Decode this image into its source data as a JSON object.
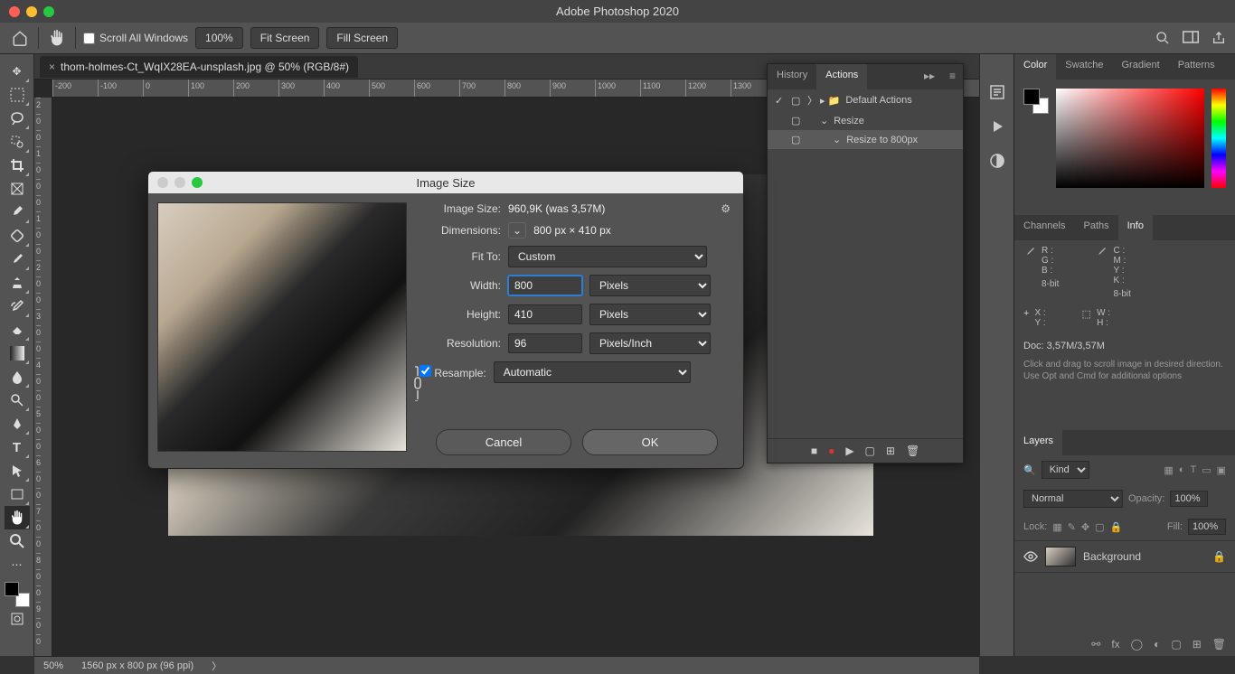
{
  "app": {
    "title": "Adobe Photoshop 2020"
  },
  "options": {
    "scroll_all": "Scroll All Windows",
    "zoom": "100%",
    "fit_screen": "Fit Screen",
    "fill_screen": "Fill Screen"
  },
  "document": {
    "tab": "thom-holmes-Ct_WqIX28EA-unsplash.jpg @ 50% (RGB/8#)",
    "status_zoom": "50%",
    "status_dims": "1560 px x 800 px (96 ppi)"
  },
  "ruler_h": [
    "-200",
    "-100",
    "0",
    "100",
    "200",
    "300",
    "400",
    "500",
    "600",
    "700",
    "800",
    "900",
    "1000",
    "1100",
    "1200",
    "1300"
  ],
  "ruler_v": [
    "2",
    "0",
    "0",
    "1",
    "0",
    "0",
    "0",
    "1",
    "0",
    "0",
    "2",
    "0",
    "0",
    "3",
    "0",
    "0",
    "4",
    "0",
    "0",
    "5",
    "0",
    "0",
    "6",
    "0",
    "0",
    "7",
    "0",
    "0",
    "8",
    "0",
    "0",
    "9",
    "0",
    "0"
  ],
  "actions_panel": {
    "tab_history": "History",
    "tab_actions": "Actions",
    "items": [
      {
        "label": "Default Actions",
        "indent": 0,
        "checked": true,
        "folder": true
      },
      {
        "label": "Resize",
        "indent": 1,
        "checked": false,
        "open": true
      },
      {
        "label": "Resize to 800px",
        "indent": 2,
        "checked": false,
        "selected": true
      }
    ]
  },
  "panels": {
    "color": {
      "tabs": [
        "Color",
        "Swatche",
        "Gradient",
        "Patterns"
      ],
      "active": 0
    },
    "info": {
      "tabs": [
        "Channels",
        "Paths",
        "Info"
      ],
      "active": 2,
      "rgb": {
        "R": "R :",
        "G": "G :",
        "B": "B :",
        "bit1": "8-bit"
      },
      "cmyk": {
        "C": "C :",
        "M": "M :",
        "Y": "Y :",
        "K": "K :",
        "bit2": "8-bit"
      },
      "xy": {
        "X": "X :",
        "Y": "Y :"
      },
      "wh": {
        "W": "W :",
        "H": "H :"
      },
      "doc": "Doc: 3,57M/3,57M",
      "hint": "Click and drag to scroll image in desired direction.  Use Opt and Cmd for additional options"
    },
    "layers": {
      "tabs": [
        "Layers"
      ],
      "active": 0,
      "kind": "Kind",
      "blend": "Normal",
      "opacity_label": "Opacity:",
      "opacity": "100%",
      "lock_label": "Lock:",
      "fill_label": "Fill:",
      "fill": "100%",
      "layer_name": "Background"
    }
  },
  "dialog": {
    "title": "Image Size",
    "image_size_label": "Image Size:",
    "image_size_value": "960,9K (was 3,57M)",
    "dimensions_label": "Dimensions:",
    "dimensions_value": "800 px  ×  410 px",
    "fit_to_label": "Fit To:",
    "fit_to_value": "Custom",
    "width_label": "Width:",
    "width_value": "800",
    "width_unit": "Pixels",
    "height_label": "Height:",
    "height_value": "410",
    "height_unit": "Pixels",
    "resolution_label": "Resolution:",
    "resolution_value": "96",
    "resolution_unit": "Pixels/Inch",
    "resample_label": "Resample:",
    "resample_value": "Automatic",
    "cancel": "Cancel",
    "ok": "OK"
  }
}
